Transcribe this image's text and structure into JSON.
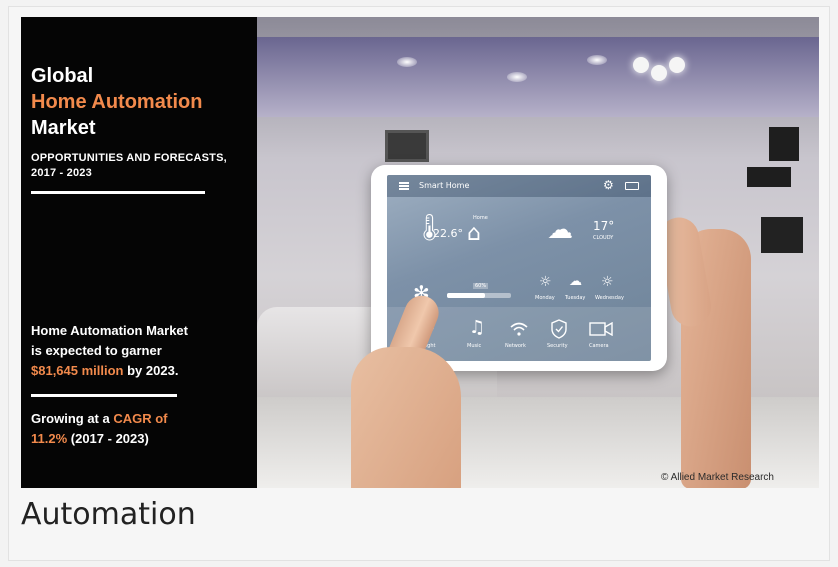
{
  "banner": {
    "title_line1": "Global",
    "title_line2": "Home Automation",
    "title_line3": "Market",
    "subtitle_line1": "OPPORTUNITIES AND FORECASTS,",
    "subtitle_line2": "2017 - 2023",
    "stat1_line1": "Home Automation Market",
    "stat1_line2": "is expected to garner",
    "stat1_highlight": "$81,645 million",
    "stat1_rest": " by 2023.",
    "stat2_prefix": "Growing at a ",
    "stat2_highlight1": "CAGR of",
    "stat2_highlight2": "11.2%",
    "stat2_rest": " (2017 - 2023)",
    "copyright": "© Allied Market Research"
  },
  "tablet_screen": {
    "app_title": "Smart Home",
    "indoor_temp": "22.6°",
    "home_label": "Home",
    "outdoor_temp": "17°",
    "weather_desc": "CLOUDY",
    "fan_level": "60%",
    "forecast": [
      {
        "day": "Monday",
        "icon": "sun-icon"
      },
      {
        "day": "Tuesday",
        "icon": "rain-cloud-icon"
      },
      {
        "day": "Wednesday",
        "icon": "sun-icon"
      }
    ],
    "bottom_items": [
      {
        "label": "Light",
        "icon": "bulb-icon"
      },
      {
        "label": "Music",
        "icon": "music-note-icon"
      },
      {
        "label": "Network",
        "icon": "wifi-icon"
      },
      {
        "label": "Security",
        "icon": "shield-icon"
      },
      {
        "label": "Camera",
        "icon": "camera-icon"
      }
    ]
  },
  "caption": "Automation",
  "colors": {
    "accent": "#f28a4c",
    "panel": "#050505",
    "page_background": "#f3f3f3"
  }
}
